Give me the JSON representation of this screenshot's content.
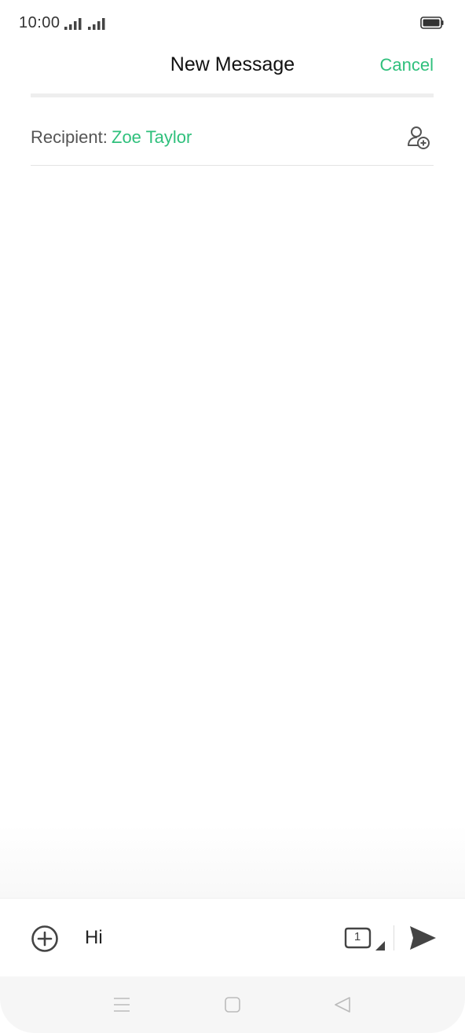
{
  "status_bar": {
    "time": "10:00"
  },
  "header": {
    "title": "New Message",
    "cancel_label": "Cancel"
  },
  "recipient": {
    "label": "Recipient:",
    "name": "Zoe Taylor"
  },
  "compose": {
    "text": "Hi",
    "sim_slot": "1"
  },
  "colors": {
    "accent": "#2fc07c",
    "text_primary": "#111111",
    "text_secondary": "#555555",
    "icon": "#444444"
  },
  "icons": {
    "add_contact": "add-contact-icon",
    "attach": "plus-circle-icon",
    "sim": "sim-card-icon",
    "send": "send-icon",
    "nav_menu": "menu-icon",
    "nav_home": "home-icon",
    "nav_back": "back-icon"
  }
}
